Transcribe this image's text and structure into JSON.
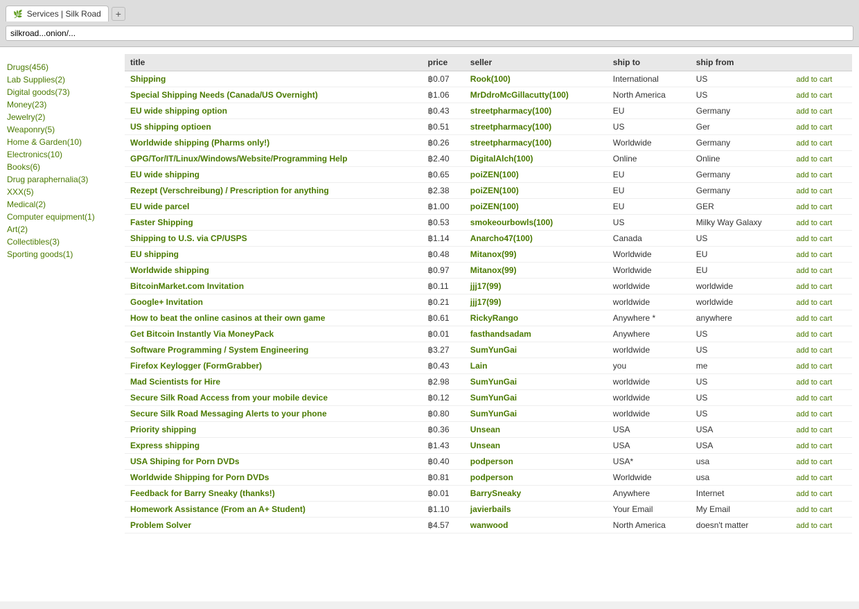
{
  "browser": {
    "tab_label": "Services | Silk Road",
    "tab_icon": "🌿",
    "new_tab_symbol": "+",
    "address_bar_value": "silkroad...onion/..."
  },
  "sidebar": {
    "items": [
      {
        "label": "Drugs(456)",
        "id": "drugs"
      },
      {
        "label": "Lab Supplies(2)",
        "id": "lab-supplies"
      },
      {
        "label": "Digital goods(73)",
        "id": "digital-goods"
      },
      {
        "label": "Money(23)",
        "id": "money"
      },
      {
        "label": "Jewelry(2)",
        "id": "jewelry"
      },
      {
        "label": "Weaponry(5)",
        "id": "weaponry"
      },
      {
        "label": "Home & Garden(10)",
        "id": "home-garden"
      },
      {
        "label": "Electronics(10)",
        "id": "electronics"
      },
      {
        "label": "Books(6)",
        "id": "books"
      },
      {
        "label": "Drug paraphernalia(3)",
        "id": "drug-paraphernalia"
      },
      {
        "label": "XXX(5)",
        "id": "xxx"
      },
      {
        "label": "Medical(2)",
        "id": "medical"
      },
      {
        "label": "Computer equipment(1)",
        "id": "computer-equipment"
      },
      {
        "label": "Art(2)",
        "id": "art"
      },
      {
        "label": "Collectibles(3)",
        "id": "collectibles"
      },
      {
        "label": "Sporting goods(1)",
        "id": "sporting-goods"
      }
    ]
  },
  "table": {
    "headers": [
      "title",
      "price",
      "seller",
      "ship to",
      "ship from",
      ""
    ],
    "rows": [
      {
        "title": "Shipping",
        "price": "฿0.07",
        "seller": "Rook(100)",
        "ship_to": "International",
        "ship_from": "US",
        "action": "add to cart"
      },
      {
        "title": "Special Shipping Needs (Canada/US Overnight)",
        "price": "฿1.06",
        "seller": "MrDdroMcGillacutty(100)",
        "ship_to": "North America",
        "ship_from": "US",
        "action": "add to cart"
      },
      {
        "title": "EU wide shipping option",
        "price": "฿0.43",
        "seller": "streetpharmacy(100)",
        "ship_to": "EU",
        "ship_from": "Germany",
        "action": "add to cart"
      },
      {
        "title": "US shipping optioen",
        "price": "฿0.51",
        "seller": "streetpharmacy(100)",
        "ship_to": "US",
        "ship_from": "Ger",
        "action": "add to cart"
      },
      {
        "title": "Worldwide shipping (Pharms only!)",
        "price": "฿0.26",
        "seller": "streetpharmacy(100)",
        "ship_to": "Worldwide",
        "ship_from": "Germany",
        "action": "add to cart"
      },
      {
        "title": "GPG/Tor/IT/Linux/Windows/Website/Programming Help",
        "price": "฿2.40",
        "seller": "DigitalAlch(100)",
        "ship_to": "Online",
        "ship_from": "Online",
        "action": "add to cart"
      },
      {
        "title": "EU wide shipping",
        "price": "฿0.65",
        "seller": "poiZEN(100)",
        "ship_to": "EU",
        "ship_from": "Germany",
        "action": "add to cart"
      },
      {
        "title": "Rezept (Verschreibung) / Prescription for anything",
        "price": "฿2.38",
        "seller": "poiZEN(100)",
        "ship_to": "EU",
        "ship_from": "Germany",
        "action": "add to cart"
      },
      {
        "title": "EU wide parcel",
        "price": "฿1.00",
        "seller": "poiZEN(100)",
        "ship_to": "EU",
        "ship_from": "GER",
        "action": "add to cart"
      },
      {
        "title": "Faster Shipping",
        "price": "฿0.53",
        "seller": "smokeourbowls(100)",
        "ship_to": "US",
        "ship_from": "Milky Way Galaxy",
        "action": "add to cart"
      },
      {
        "title": "Shipping to U.S. via CP/USPS",
        "price": "฿1.14",
        "seller": "Anarcho47(100)",
        "ship_to": "Canada",
        "ship_from": "US",
        "action": "add to cart"
      },
      {
        "title": "EU shipping",
        "price": "฿0.48",
        "seller": "Mitanox(99)",
        "ship_to": "Worldwide",
        "ship_from": "EU",
        "action": "add to cart"
      },
      {
        "title": "Worldwide shipping",
        "price": "฿0.97",
        "seller": "Mitanox(99)",
        "ship_to": "Worldwide",
        "ship_from": "EU",
        "action": "add to cart"
      },
      {
        "title": "BitcoinMarket.com Invitation",
        "price": "฿0.11",
        "seller": "jjj17(99)",
        "ship_to": "worldwide",
        "ship_from": "worldwide",
        "action": "add to cart"
      },
      {
        "title": "Google+ Invitation",
        "price": "฿0.21",
        "seller": "jjj17(99)",
        "ship_to": "worldwide",
        "ship_from": "worldwide",
        "action": "add to cart"
      },
      {
        "title": "How to beat the online casinos at their own game",
        "price": "฿0.61",
        "seller": "RickyRango",
        "ship_to": "Anywhere *",
        "ship_from": "anywhere",
        "action": "add to cart"
      },
      {
        "title": "Get Bitcoin Instantly Via MoneyPack",
        "price": "฿0.01",
        "seller": "fasthandsadam",
        "ship_to": "Anywhere",
        "ship_from": "US",
        "action": "add to cart"
      },
      {
        "title": "Software Programming / System Engineering",
        "price": "฿3.27",
        "seller": "SumYunGai",
        "ship_to": "worldwide",
        "ship_from": "US",
        "action": "add to cart"
      },
      {
        "title": "Firefox Keylogger (FormGrabber)",
        "price": "฿0.43",
        "seller": "Lain",
        "ship_to": "you",
        "ship_from": "me",
        "action": "add to cart"
      },
      {
        "title": "Mad Scientists for Hire",
        "price": "฿2.98",
        "seller": "SumYunGai",
        "ship_to": "worldwide",
        "ship_from": "US",
        "action": "add to cart"
      },
      {
        "title": "Secure Silk Road Access from your mobile device",
        "price": "฿0.12",
        "seller": "SumYunGai",
        "ship_to": "worldwide",
        "ship_from": "US",
        "action": "add to cart"
      },
      {
        "title": "Secure Silk Road Messaging Alerts to your phone",
        "price": "฿0.80",
        "seller": "SumYunGai",
        "ship_to": "worldwide",
        "ship_from": "US",
        "action": "add to cart"
      },
      {
        "title": "Priority shipping",
        "price": "฿0.36",
        "seller": "Unsean",
        "ship_to": "USA",
        "ship_from": "USA",
        "action": "add to cart"
      },
      {
        "title": "Express shipping",
        "price": "฿1.43",
        "seller": "Unsean",
        "ship_to": "USA",
        "ship_from": "USA",
        "action": "add to cart"
      },
      {
        "title": "USA Shiping for Porn DVDs",
        "price": "฿0.40",
        "seller": "podperson",
        "ship_to": "USA*",
        "ship_from": "usa",
        "action": "add to cart"
      },
      {
        "title": "Worldwide Shipping for Porn DVDs",
        "price": "฿0.81",
        "seller": "podperson",
        "ship_to": "Worldwide",
        "ship_from": "usa",
        "action": "add to cart"
      },
      {
        "title": "Feedback for Barry Sneaky (thanks!)",
        "price": "฿0.01",
        "seller": "BarrySneaky",
        "ship_to": "Anywhere",
        "ship_from": "Internet",
        "action": "add to cart"
      },
      {
        "title": "Homework Assistance (From an A+ Student)",
        "price": "฿1.10",
        "seller": "javierbails",
        "ship_to": "Your Email",
        "ship_from": "My Email",
        "action": "add to cart"
      },
      {
        "title": "Problem Solver",
        "price": "฿4.57",
        "seller": "wanwood",
        "ship_to": "North America",
        "ship_from": "doesn't matter",
        "action": "add to cart"
      }
    ]
  }
}
